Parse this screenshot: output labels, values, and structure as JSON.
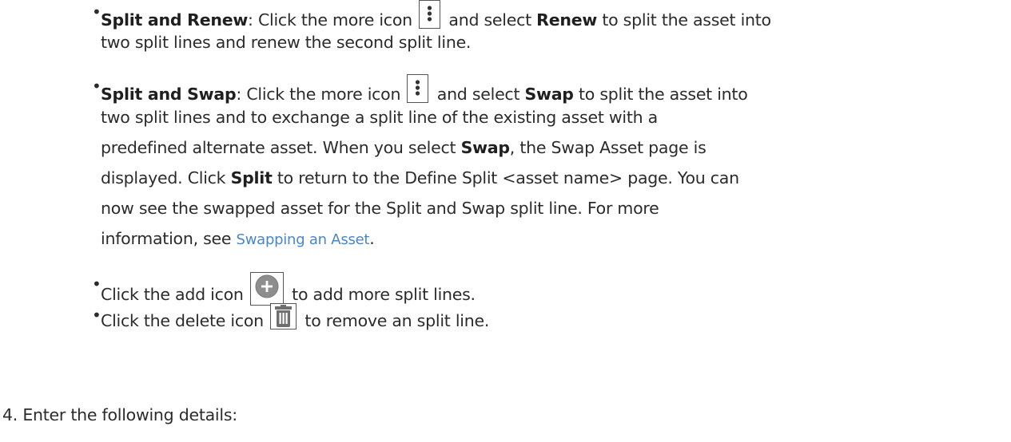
{
  "items": [
    {
      "bullet": "•",
      "lines": [
        {
          "pre": "",
          "bold": "Split and Renew",
          "mid": ": Click the more icon ",
          "bold2": "Renew",
          "post_icon": " and select ",
          "post": " to split the asset into"
        },
        {
          "text": "two split lines and renew the second split line."
        }
      ]
    },
    {
      "bullet": "•",
      "bold": "Split and Swap",
      "text1_a": ": Click the more icon ",
      "text1_b": " and select ",
      "bold_swap": "Swap",
      "text1_c": " to split the asset into",
      "line2": "two split lines and to exchange a split line of the existing asset with a",
      "line3_a": "predefined alternate asset. When you select ",
      "line3_bold": "Swap",
      "line3_b": ", the Swap Asset page is",
      "line4_a": "displayed. Click ",
      "line4_bold": "Split",
      "line4_b": " to return to the Define Split <asset name> page. You can",
      "line5": "now see the swapped asset for the Split and Swap split line. For more",
      "line6_a": "information, see ",
      "line6_link": "Swapping an Asset",
      "line6_b": "."
    },
    {
      "bullet": "•",
      "text_a": "Click the add icon ",
      "text_b": " to add more split lines."
    },
    {
      "bullet": "•",
      "text_a": "Click the delete icon ",
      "text_b": " to remove an split line."
    }
  ],
  "step4": "4.  Enter the following details:",
  "icons": [
    "more-icon",
    "more-icon",
    "add-icon",
    "delete-icon"
  ],
  "colors": {
    "link": "#4a86c5",
    "add_icon": "#8e8e8e",
    "delete_icon": "#6e6e6e"
  }
}
